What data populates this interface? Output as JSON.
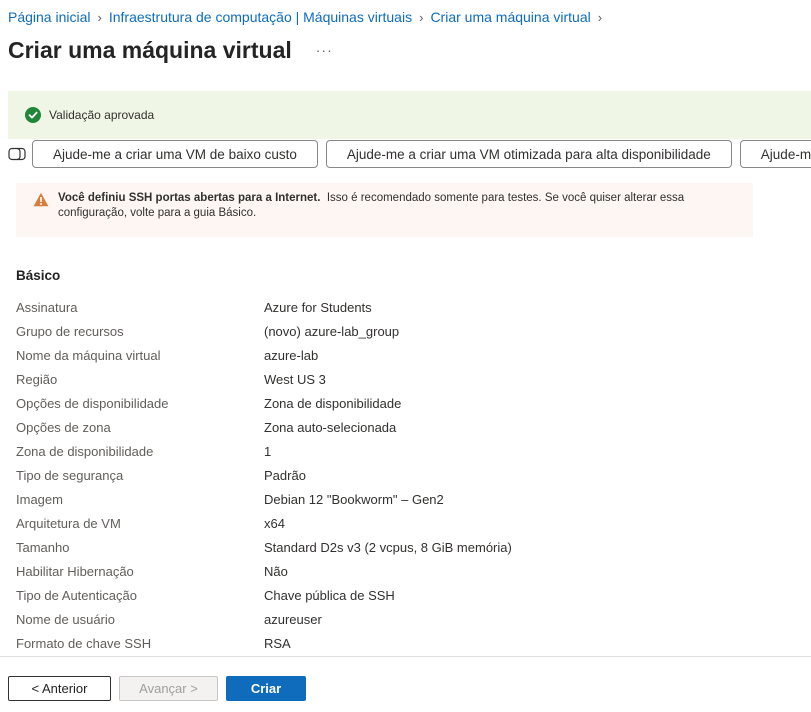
{
  "breadcrumb": {
    "items": [
      "Página inicial",
      "Infraestrutura de computação | Máquinas virtuais",
      "Criar uma máquina virtual"
    ],
    "separator_icon": "chevron-right-icon"
  },
  "page": {
    "title": "Criar uma máquina virtual",
    "more_label": "···"
  },
  "validation": {
    "text": "Validação aprovada",
    "icon": "check-circle-icon",
    "color": "#22863a",
    "background": "#eff6e5"
  },
  "copilot": {
    "icon": "copilot-icon",
    "suggestions": [
      "Ajude-me a criar uma VM de baixo custo",
      "Ajude-me a criar uma VM otimizada para alta disponibilidade",
      "Ajude-me a es"
    ]
  },
  "warning": {
    "icon": "warning-triangle-icon",
    "bold": "Você definiu SSH portas abertas para a Internet.",
    "text": "Isso é recomendado somente para testes.  Se você quiser alterar essa configuração, volte para a guia Básico.",
    "accent": "#d67f3c",
    "background": "#fdf6f2"
  },
  "basics": {
    "title": "Básico",
    "rows": [
      {
        "label": "Assinatura",
        "value": "Azure for Students"
      },
      {
        "label": "Grupo de recursos",
        "value": "(novo) azure-lab_group"
      },
      {
        "label": "Nome da máquina virtual",
        "value": "azure-lab"
      },
      {
        "label": "Região",
        "value": "West US 3"
      },
      {
        "label": "Opções de disponibilidade",
        "value": "Zona de disponibilidade"
      },
      {
        "label": "Opções de zona",
        "value": "Zona auto-selecionada"
      },
      {
        "label": "Zona de disponibilidade",
        "value": "1"
      },
      {
        "label": "Tipo de segurança",
        "value": "Padrão"
      },
      {
        "label": "Imagem",
        "value": "Debian 12 \"Bookworm\" – Gen2"
      },
      {
        "label": "Arquitetura de VM",
        "value": "x64"
      },
      {
        "label": "Tamanho",
        "value": "Standard D2s v3 (2 vcpus, 8 GiB memória)"
      },
      {
        "label": "Habilitar Hibernação",
        "value": "Não"
      },
      {
        "label": "Tipo de Autenticação",
        "value": "Chave pública de SSH"
      },
      {
        "label": "Nome de usuário",
        "value": "azureuser"
      },
      {
        "label": "Formato de chave SSH",
        "value": "RSA"
      }
    ]
  },
  "footer": {
    "previous": "< Anterior",
    "next": "Avançar >",
    "create": "Criar",
    "primary_color": "#0f6cbd"
  }
}
